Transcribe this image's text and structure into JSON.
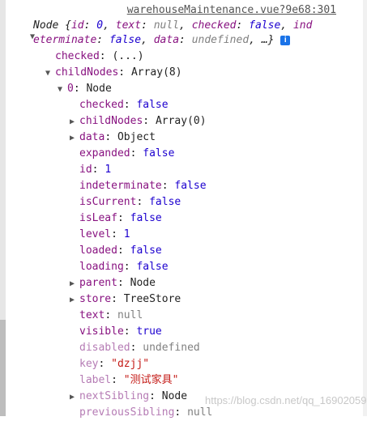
{
  "source_link": "warehouseMaintenance.vue?9e68:301",
  "summary": {
    "line1_prefix": "Node {",
    "p1_key": "id",
    "p1_val": "0",
    "p2_key": "text",
    "p2_val": "null",
    "p3_key": "checked",
    "p3_val": "false",
    "p4_key": "ind",
    "line2_cont": "eterminate",
    "p4_val": "false",
    "p5_key": "data",
    "p5_val": "undefined",
    "ellipsis": "…}",
    "info_icon": "i"
  },
  "tree": {
    "checked_row": {
      "key": "checked",
      "value": "(...)"
    },
    "childnodes_row": {
      "key": "childNodes",
      "value": "Array(8)"
    },
    "node0_row": {
      "key": "0",
      "value": "Node"
    },
    "props": [
      {
        "key": "checked",
        "value": "false",
        "type": "num",
        "arrow": false
      },
      {
        "key": "childNodes",
        "value": "Array(0)",
        "type": "obj",
        "arrow": true
      },
      {
        "key": "data",
        "value": "Object",
        "type": "obj",
        "arrow": true
      },
      {
        "key": "expanded",
        "value": "false",
        "type": "num",
        "arrow": false
      },
      {
        "key": "id",
        "value": "1",
        "type": "num",
        "arrow": false
      },
      {
        "key": "indeterminate",
        "value": "false",
        "type": "num",
        "arrow": false
      },
      {
        "key": "isCurrent",
        "value": "false",
        "type": "num",
        "arrow": false
      },
      {
        "key": "isLeaf",
        "value": "false",
        "type": "num",
        "arrow": false
      },
      {
        "key": "level",
        "value": "1",
        "type": "num",
        "arrow": false
      },
      {
        "key": "loaded",
        "value": "false",
        "type": "num",
        "arrow": false
      },
      {
        "key": "loading",
        "value": "false",
        "type": "num",
        "arrow": false
      },
      {
        "key": "parent",
        "value": "Node",
        "type": "obj",
        "arrow": true
      },
      {
        "key": "store",
        "value": "TreeStore",
        "type": "obj",
        "arrow": true
      },
      {
        "key": "text",
        "value": "null",
        "type": "null",
        "arrow": false
      },
      {
        "key": "visible",
        "value": "true",
        "type": "num",
        "arrow": false
      },
      {
        "key": "disabled",
        "value": "undefined",
        "type": "null",
        "arrow": false,
        "dim": true
      },
      {
        "key": "key",
        "value": "\"dzjj\"",
        "type": "str",
        "arrow": false,
        "dim": true
      },
      {
        "key": "label",
        "value": "\"测试家具\"",
        "type": "str",
        "arrow": false,
        "dim": true
      },
      {
        "key": "nextSibling",
        "value": "Node",
        "type": "obj",
        "arrow": true,
        "dim": true
      },
      {
        "key": "previousSibling",
        "value": "null",
        "type": "null",
        "arrow": false,
        "dim": true
      }
    ]
  },
  "watermark": "https://blog.csdn.net/qq_16902059",
  "colors": {
    "key": "#881280",
    "number": "#1c00cf",
    "string": "#c41a16",
    "null": "#808080",
    "info": "#1a73e8"
  }
}
